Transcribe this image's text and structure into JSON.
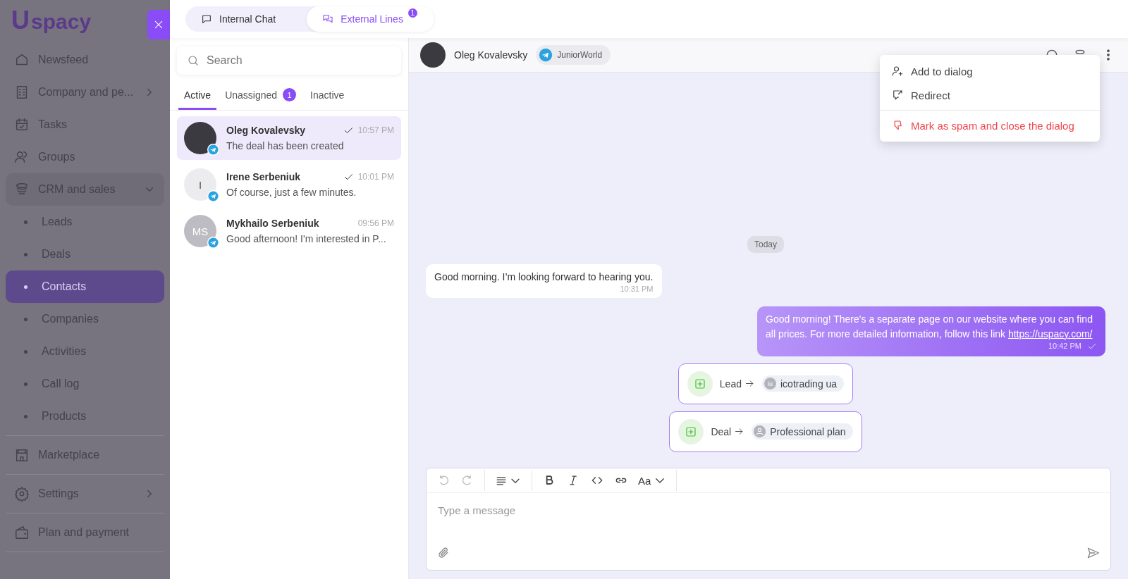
{
  "sidebar": {
    "logo": {
      "mark": "U",
      "text": "spacy"
    },
    "sections": [
      [
        {
          "label": "Newsfeed",
          "kind": "plain",
          "selected": false
        },
        {
          "label": "Company and pe...",
          "kind": "submenu",
          "selected": false
        },
        {
          "label": "Tasks",
          "kind": "plain",
          "selected": false
        },
        {
          "label": "Groups",
          "kind": "plain",
          "selected": false
        },
        {
          "label": "CRM and sales",
          "kind": "group",
          "selected": false,
          "expanded": true,
          "children": [
            {
              "label": "Leads",
              "selected": false
            },
            {
              "label": "Deals",
              "selected": false
            },
            {
              "label": "Contacts",
              "selected": true
            },
            {
              "label": "Companies",
              "selected": false
            },
            {
              "label": "Activities",
              "selected": false
            },
            {
              "label": "Call log",
              "selected": false
            },
            {
              "label": "Products",
              "selected": false
            }
          ]
        }
      ],
      [
        {
          "label": "Marketplace",
          "kind": "plain",
          "selected": false
        }
      ],
      [
        {
          "label": "Settings",
          "kind": "submenu",
          "selected": false
        }
      ],
      [
        {
          "label": "Plan and payment",
          "kind": "plain",
          "selected": false
        }
      ]
    ]
  },
  "top_tabs": [
    {
      "label": "Internal Chat",
      "selected": false
    },
    {
      "label": "External Lines",
      "selected": true,
      "badge": "1"
    }
  ],
  "chat_list": {
    "search": {
      "placeholder": "Search"
    },
    "tabs": [
      {
        "label": "Active",
        "selected": true
      },
      {
        "label": "Unassigned",
        "selected": false,
        "badge": "1"
      },
      {
        "label": "Inactive",
        "selected": false
      }
    ],
    "conversations": [
      {
        "name": "Oleg Kovalevsky",
        "preview": "The deal has been created",
        "time": "10:57 PM",
        "read": true,
        "selected": true,
        "avatar": {
          "kind": "photo"
        }
      },
      {
        "name": "Irene Serbeniuk",
        "preview": "Of course, just a few minutes.",
        "time": "10:01 PM",
        "read": true,
        "selected": false,
        "avatar": {
          "kind": "letter",
          "text": "I"
        }
      },
      {
        "name": "Mykhailo Serbeniuk",
        "preview": "Good afternoon! I'm interested in P...",
        "time": "09:56 PM",
        "read": false,
        "selected": false,
        "avatar": {
          "kind": "initials",
          "text": "MS"
        }
      }
    ]
  },
  "chat": {
    "header": {
      "name": "Oleg Kovalevsky",
      "channel": "JuniorWorld"
    },
    "menu": [
      {
        "label": "Add to dialog",
        "kind": "normal"
      },
      {
        "label": "Redirect",
        "kind": "normal"
      },
      {
        "label": "Mark as spam and close the dialog",
        "kind": "danger"
      }
    ],
    "date": "Today",
    "messages": [
      {
        "kind": "incoming",
        "text": "Good morning. I’m looking forward to hearing you.",
        "time": "10:31 PM"
      },
      {
        "kind": "outgoing",
        "text": "Good morning! There's a separate page on our website where you can find all prices. For more detailed information, follow this link",
        "link": "https://uspacy.com/",
        "time": "10:42 PM",
        "read": true
      },
      {
        "kind": "event",
        "entity": "Lead",
        "target": "icotrading ua",
        "target_avatar": {
          "kind": "initials",
          "text": "iu"
        }
      },
      {
        "kind": "event",
        "entity": "Deal",
        "target": "Professional plan",
        "target_avatar": {
          "kind": "icon"
        }
      }
    ],
    "composer": {
      "font_label": "Aa",
      "placeholder": "Type a message"
    }
  }
}
